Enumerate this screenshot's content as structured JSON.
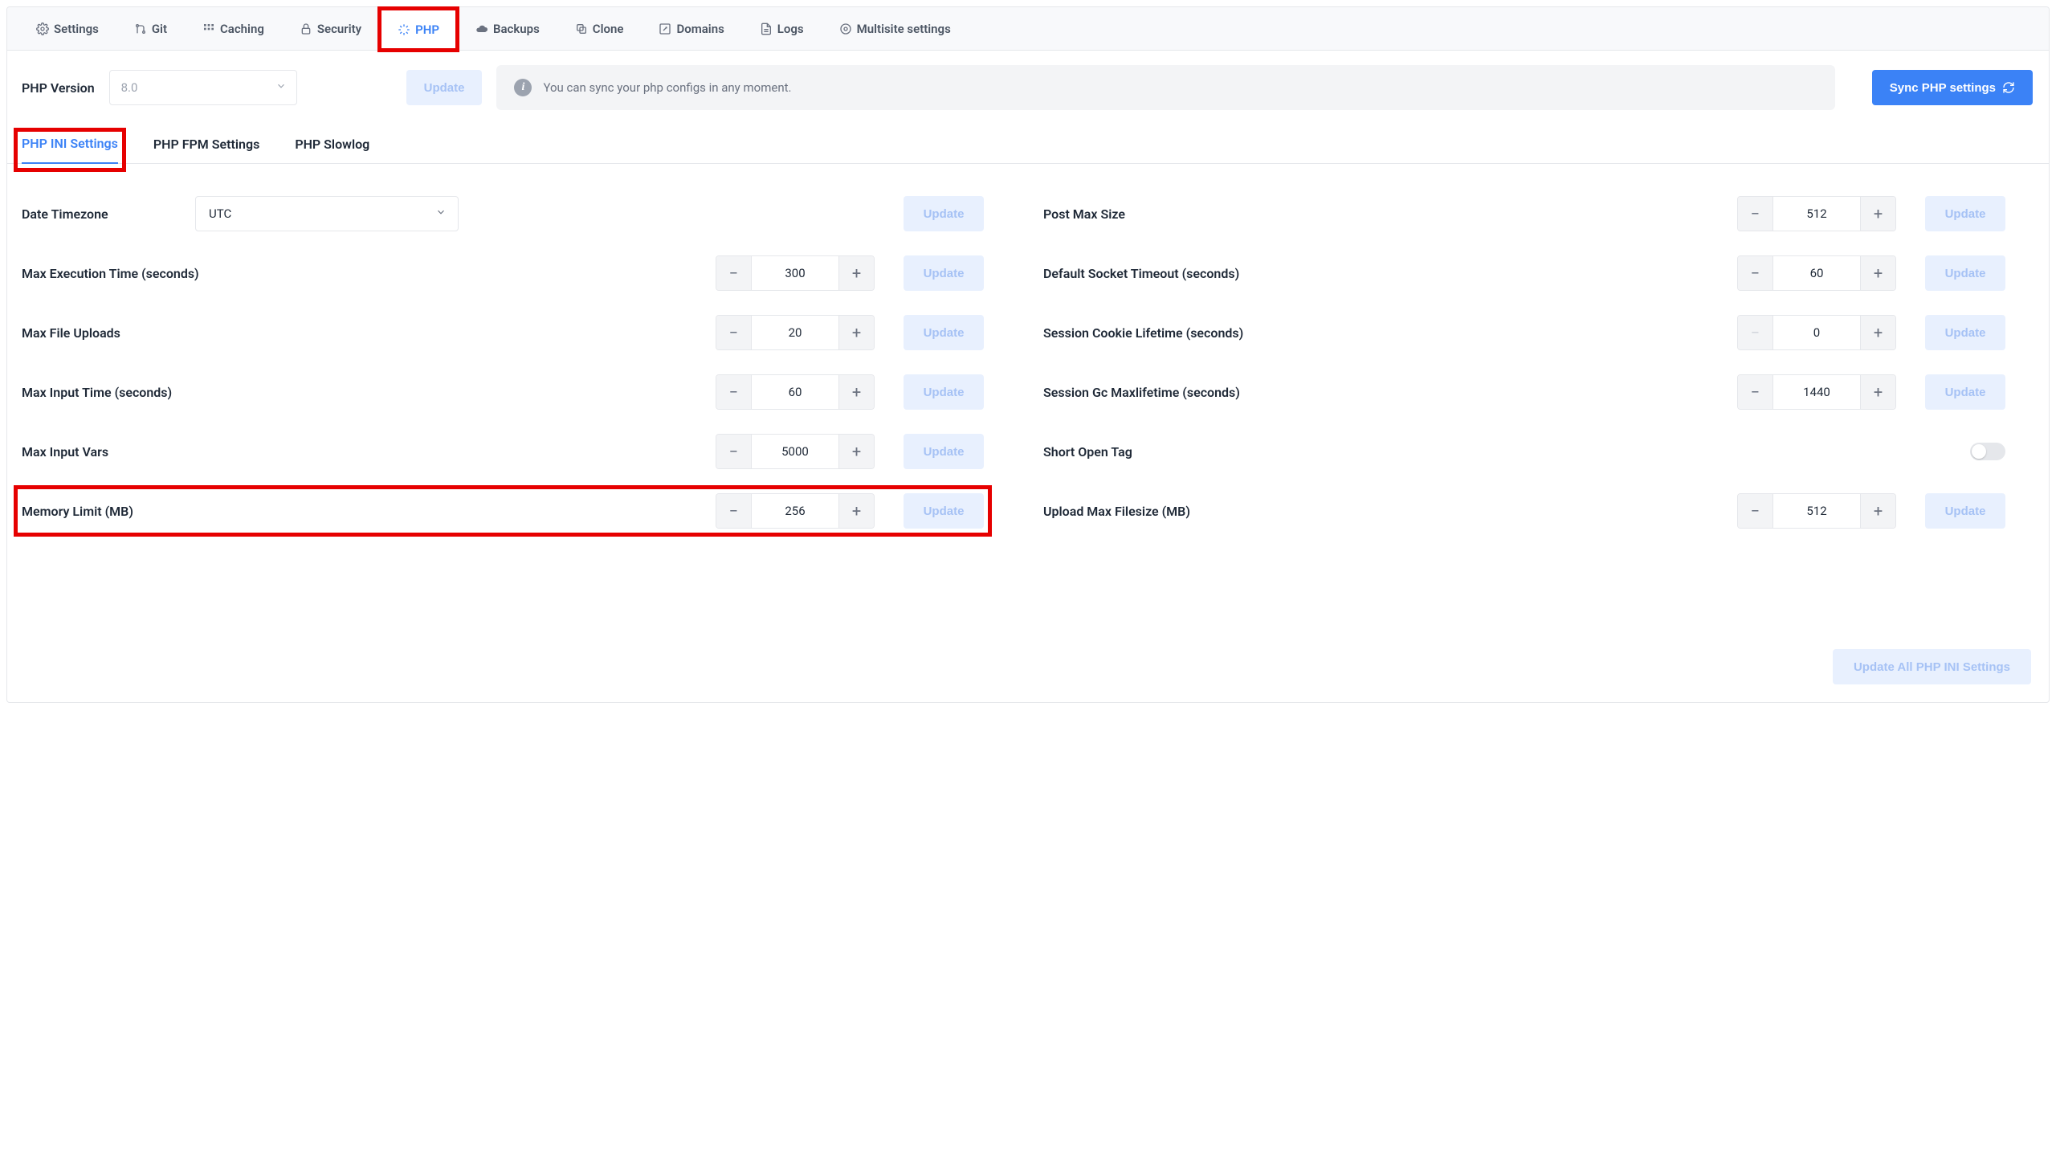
{
  "top_tabs": {
    "settings": "Settings",
    "git": "Git",
    "caching": "Caching",
    "security": "Security",
    "php": "PHP",
    "backups": "Backups",
    "clone": "Clone",
    "domains": "Domains",
    "logs": "Logs",
    "multisite": "Multisite settings"
  },
  "header": {
    "version_label": "PHP Version",
    "version_value": "8.0",
    "update_btn": "Update",
    "info_text": "You can sync your php configs in any moment.",
    "sync_btn": "Sync PHP settings"
  },
  "sub_tabs": {
    "ini": "PHP INI Settings",
    "fpm": "PHP FPM Settings",
    "slowlog": "PHP Slowlog"
  },
  "settings_left": [
    {
      "key": "date_timezone",
      "label": "Date Timezone",
      "type": "select",
      "value": "UTC"
    },
    {
      "key": "max_execution_time",
      "label": "Max Execution Time (seconds)",
      "type": "stepper",
      "value": "300"
    },
    {
      "key": "max_file_uploads",
      "label": "Max File Uploads",
      "type": "stepper",
      "value": "20"
    },
    {
      "key": "max_input_time",
      "label": "Max Input Time (seconds)",
      "type": "stepper",
      "value": "60"
    },
    {
      "key": "max_input_vars",
      "label": "Max Input Vars",
      "type": "stepper",
      "value": "5000"
    },
    {
      "key": "memory_limit",
      "label": "Memory Limit (MB)",
      "type": "stepper",
      "value": "256"
    }
  ],
  "settings_right": [
    {
      "key": "post_max_size",
      "label": "Post Max Size",
      "type": "stepper",
      "value": "512"
    },
    {
      "key": "default_socket_timeout",
      "label": "Default Socket Timeout (seconds)",
      "type": "stepper",
      "value": "60"
    },
    {
      "key": "session_cookie_lifetime",
      "label": "Session Cookie Lifetime (seconds)",
      "type": "stepper",
      "value": "0",
      "minus_disabled": true
    },
    {
      "key": "session_gc_maxlifetime",
      "label": "Session Gc Maxlifetime (seconds)",
      "type": "stepper",
      "value": "1440"
    },
    {
      "key": "short_open_tag",
      "label": "Short Open Tag",
      "type": "toggle"
    },
    {
      "key": "upload_max_filesize",
      "label": "Upload Max Filesize (MB)",
      "type": "stepper",
      "value": "512"
    }
  ],
  "update_label": "Update",
  "update_all_label": "Update All PHP INI Settings"
}
